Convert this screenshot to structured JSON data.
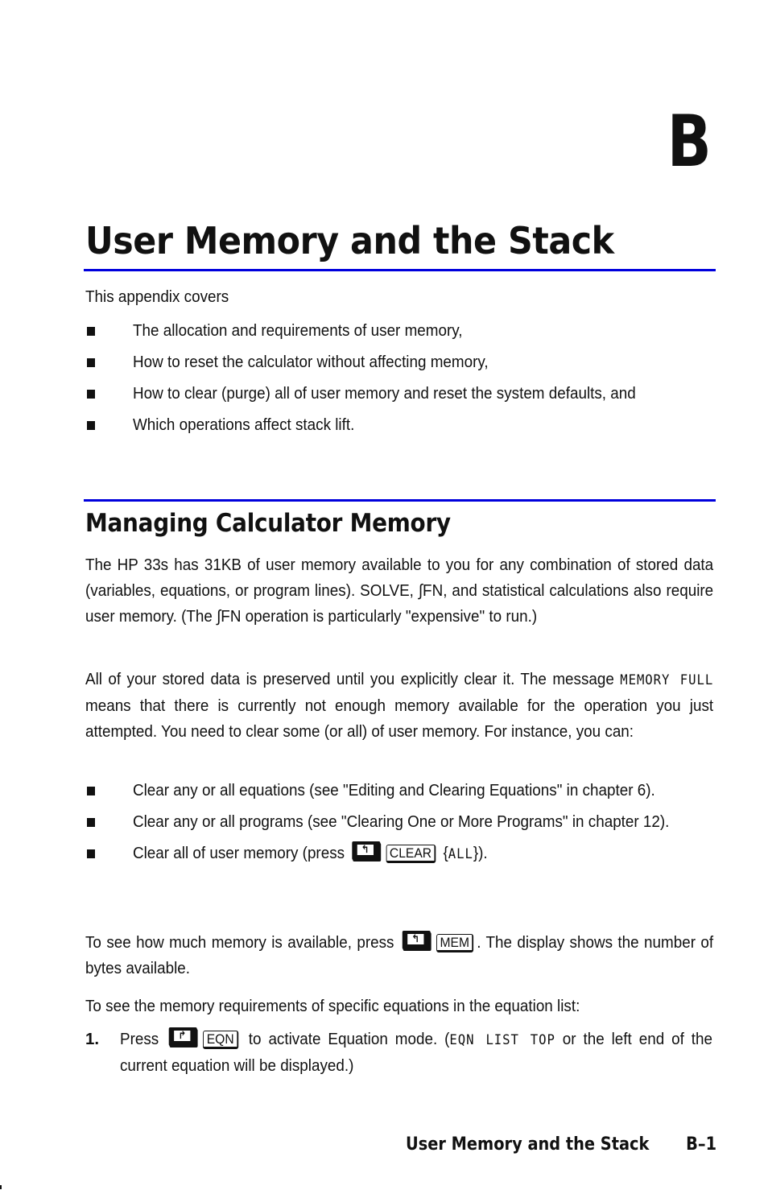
{
  "chapter": {
    "letter": "B",
    "title": "User Memory and the Stack"
  },
  "intro": {
    "lead": "This appendix covers",
    "bullets": [
      "The allocation and requirements of user memory,",
      "How to reset the calculator without affecting memory,",
      "How to clear (purge) all of user memory and reset the system defaults, and",
      "Which operations affect stack lift."
    ]
  },
  "section": {
    "title": "Managing Calculator Memory",
    "p1": "The HP 33s has 31KB of user memory available to you for any combination of stored data (variables, equations, or program lines). SOLVE, ∫FN, and statistical calculations also require user memory. (The ∫FN operation is particularly \"expensive\" to run.)",
    "p2_start": "All of your stored data is preserved until you explicitly clear it. The message ",
    "p2_lcd": "MEMORY FULL",
    "p2_end": " means that there is currently not enough memory available for the operation you just attempted. You need to clear some (or all) of user memory. For instance, you can:",
    "bullets": [
      "Clear any or all equations (see \"Editing and Clearing Equations\" in chapter 6).",
      "Clear any or all programs (see \"Clearing One or More Programs\" in chapter 12)."
    ],
    "bullet3_start": "Clear all of user memory (press ",
    "bullet3_key_shift": "↰",
    "bullet3_key": "CLEAR",
    "bullet3_menu_open": " {",
    "bullet3_lcd": "ALL",
    "bullet3_end": "}).",
    "p3_start": "To see how much memory is available, press ",
    "p3_key_shift": "↰",
    "p3_key": "MEM",
    "p3_end": ". The display shows the number of bytes available.",
    "p4": "To see the memory requirements of specific equations in the equation list:",
    "step1": {
      "number": "1.",
      "start": "Press ",
      "key_shift": "↱",
      "key": "EQN",
      "middle": " to activate Equation mode. (",
      "lcd": "EQN LIST TOP",
      "end": " or the left end of the current equation will be displayed.)"
    }
  },
  "footer": {
    "title": "User Memory and the Stack",
    "page": "B–1"
  },
  "colors": {
    "rule": "#0000dd",
    "text": "#111111"
  }
}
